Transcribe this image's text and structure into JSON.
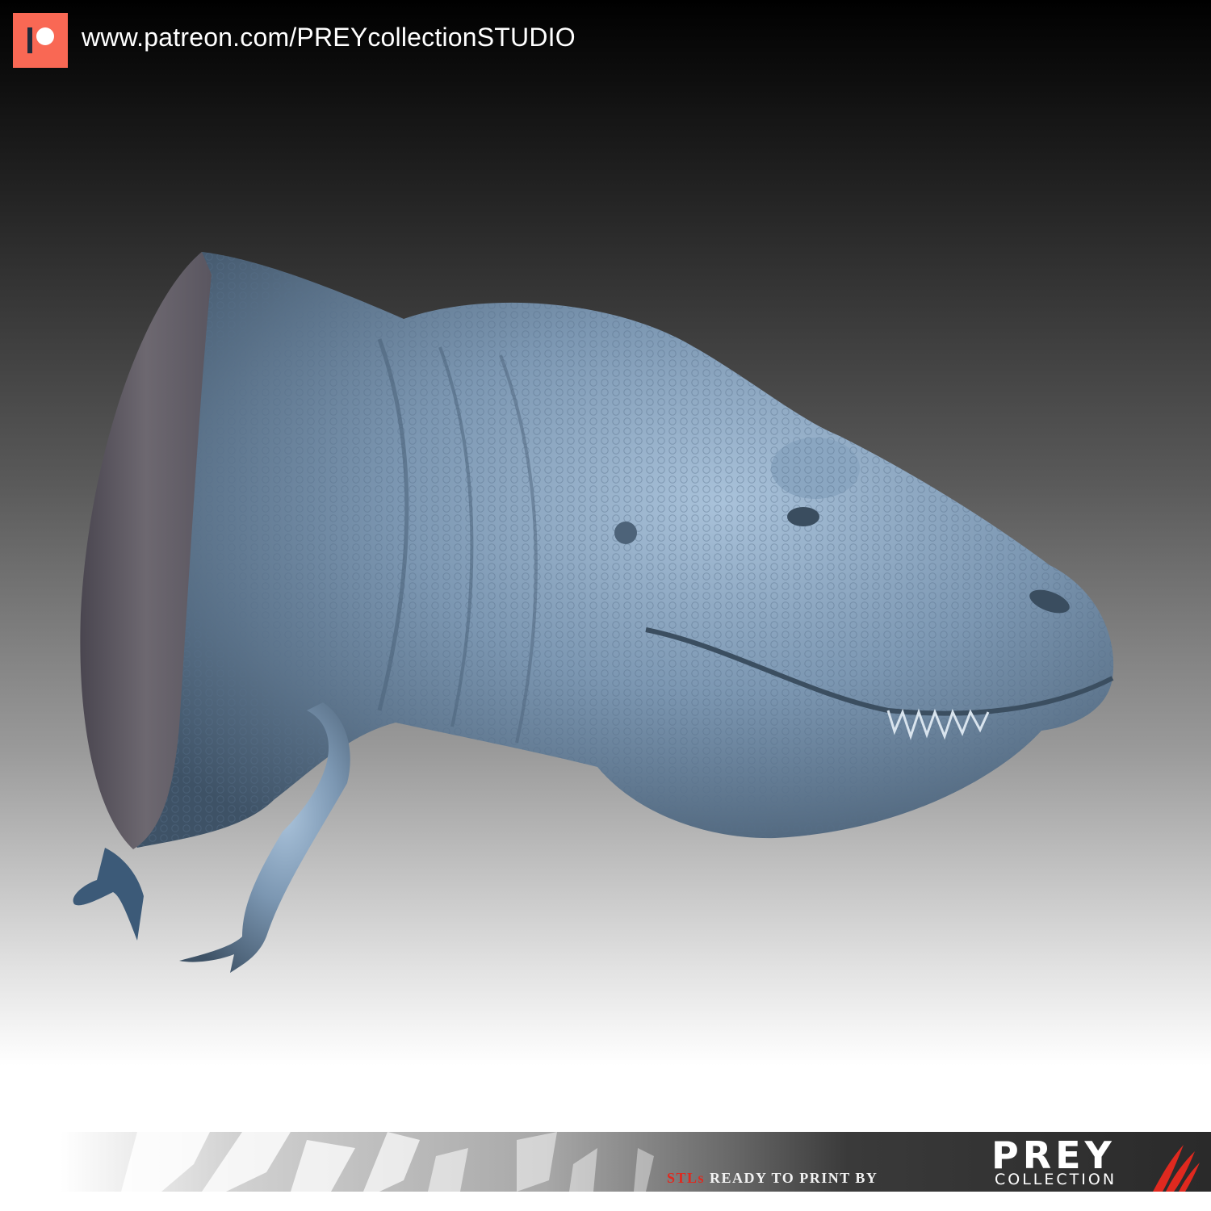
{
  "header": {
    "icon": "patreon-icon",
    "brand_color": "#f96854",
    "url": "www.patreon.com/PREYcollectionSTUDIO"
  },
  "subject": {
    "skin_color": "#7c97b2"
  },
  "footer": {
    "tagline_prefix": "STLs",
    "tagline_rest": " READY TO PRINT BY",
    "brand": "PREY",
    "brand_sub": "COLLECTION",
    "accent_color": "#e0291f"
  }
}
